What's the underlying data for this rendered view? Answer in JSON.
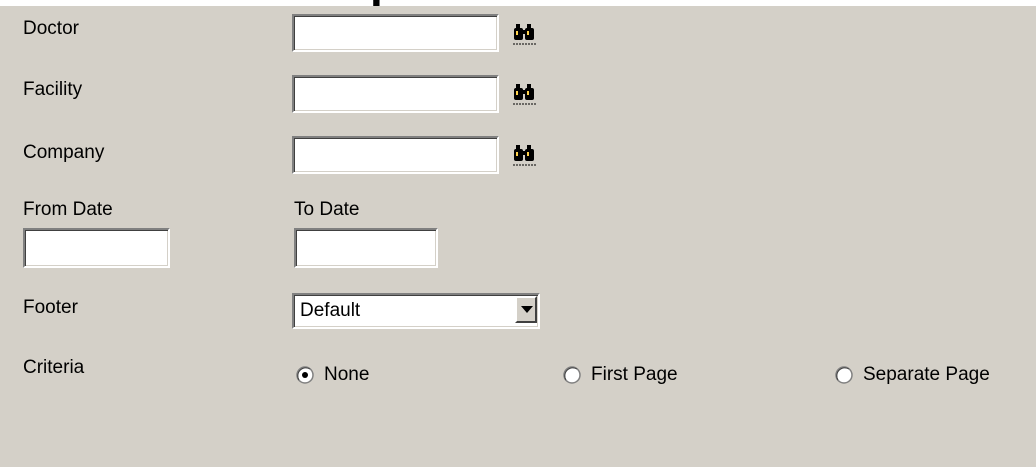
{
  "header": {
    "title_fragment": "p"
  },
  "form": {
    "doctor": {
      "label": "Doctor",
      "value": "",
      "lookup_icon": "binoculars-icon"
    },
    "facility": {
      "label": "Facility",
      "value": "",
      "lookup_icon": "binoculars-icon"
    },
    "company": {
      "label": "Company",
      "value": "",
      "lookup_icon": "binoculars-icon"
    },
    "from_date": {
      "label": "From Date",
      "value": ""
    },
    "to_date": {
      "label": "To Date",
      "value": ""
    },
    "footer": {
      "label": "Footer",
      "selected": "Default"
    },
    "criteria": {
      "label": "Criteria",
      "options": [
        "None",
        "First Page",
        "Separate Page"
      ],
      "selected": "None"
    }
  },
  "colors": {
    "window_bg": "#d4d0c8",
    "field_bg": "#ffffff"
  }
}
